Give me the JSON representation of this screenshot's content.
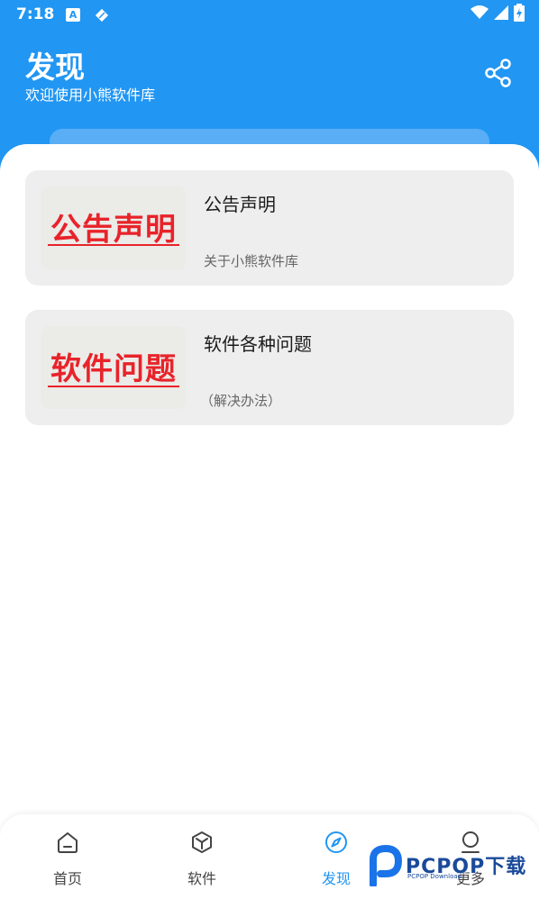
{
  "status_bar": {
    "time": "7:18",
    "notification_icons": [
      "a-badge-icon",
      "diamond-icon"
    ],
    "system_icons": [
      "wifi-icon",
      "signal-icon",
      "battery-charging-icon"
    ]
  },
  "header": {
    "title": "发现",
    "subtitle": "欢迎使用小熊软件库",
    "share_icon": "share-icon"
  },
  "cards": [
    {
      "thumbnail_text": "公告声明",
      "title": "公告声明",
      "description": "关于小熊软件库"
    },
    {
      "thumbnail_text": "软件问题",
      "title": "软件各种问题",
      "description": "（解决办法）"
    }
  ],
  "bottom_nav": {
    "items": [
      {
        "label": "首页",
        "icon": "home-icon",
        "active": false
      },
      {
        "label": "软件",
        "icon": "cube-icon",
        "active": false
      },
      {
        "label": "发现",
        "icon": "compass-icon",
        "active": true
      },
      {
        "label": "更多",
        "icon": "person-icon",
        "active": false
      }
    ]
  },
  "watermark": {
    "text": "PCPOP下载",
    "subtext": "PCPOP Download"
  },
  "colors": {
    "primary": "#2196f3",
    "card_background": "#eeeeee",
    "thumbnail_red": "#e8232a"
  }
}
